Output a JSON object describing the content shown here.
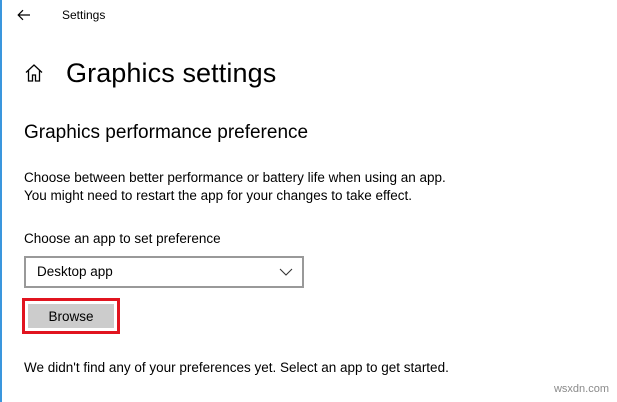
{
  "window": {
    "title": "Settings",
    "back_icon": "back-arrow-icon",
    "accent_color": "#3a96dd"
  },
  "header": {
    "home_icon": "home-icon",
    "title": "Graphics settings"
  },
  "section": {
    "title": "Graphics performance preference",
    "description_line1": "Choose between better performance or battery life when using an app.",
    "description_line2": "You might need to restart the app for your changes to take effect."
  },
  "app_picker": {
    "label": "Choose an app to set preference",
    "selected": "Desktop app",
    "chevron_icon": "chevron-down-icon"
  },
  "browse": {
    "label": "Browse",
    "highlight_color": "#e1141f",
    "button_color": "#cccccc"
  },
  "status": {
    "text": "We didn't find any of your preferences yet. Select an app to get started."
  },
  "watermark": {
    "text": "wsxdn.com"
  }
}
